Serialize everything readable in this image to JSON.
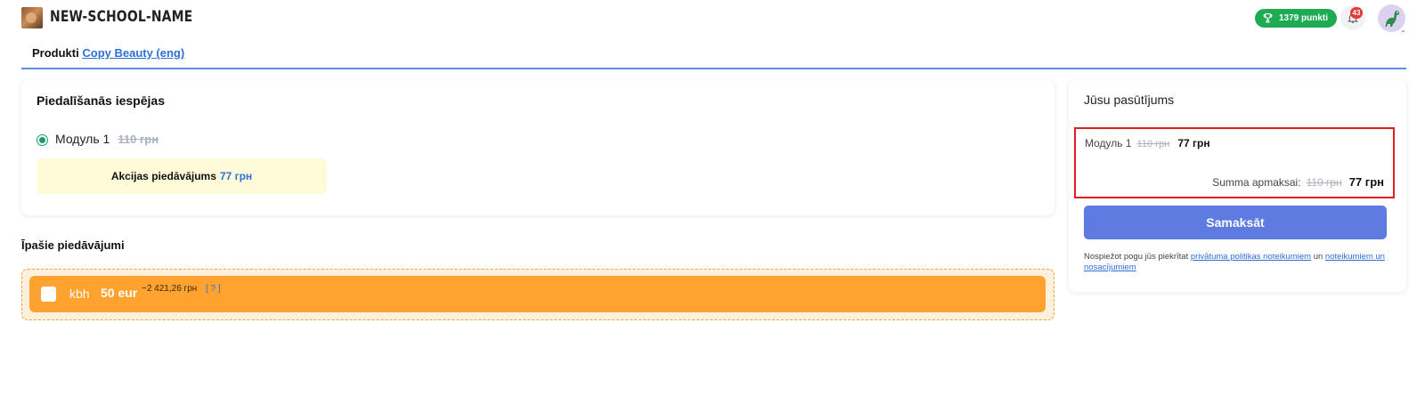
{
  "header": {
    "school_name": "NEW-SCHOOL-NAME",
    "points_label": "1379 punkti",
    "notifications_count": "43"
  },
  "breadcrumb": {
    "prefix": "Produkti",
    "link": "Copy Beauty (eng)"
  },
  "participation": {
    "title": "Piedalīšanās iespējas",
    "option_label": "Модуль 1",
    "option_old_price": "110 грн",
    "promo_label": "Akcijas piedāvājums",
    "promo_price": "77 грн"
  },
  "special_offers": {
    "title": "Īpašie piedāvājumi",
    "item_name": "kbh",
    "item_price": "50 eur",
    "item_approx": "~2 421,26 грн",
    "item_help": "[ ? ]"
  },
  "order": {
    "title": "Jūsu pasūtījums",
    "line_label": "Модуль 1",
    "line_old_price": "110 грн",
    "line_new_price": "77 грн",
    "sum_label": "Summa apmaksai:",
    "sum_old_price": "110 грн",
    "sum_new_price": "77 грн",
    "pay_label": "Samaksāt",
    "terms_prefix": "Nospiežot pogu jūs piekrītat",
    "terms_link1": "privātuma politikas noteikumiem",
    "terms_and": "un",
    "terms_link2": "noteikumiem un nosacījumiem"
  },
  "colors": {
    "accent_blue": "#5e7be2",
    "link_blue": "#2e6fd8",
    "points_green": "#1fab54",
    "offer_orange": "#ffa230",
    "highlight_red": "#e02020"
  },
  "icons": [
    "trophy-icon",
    "bell-icon",
    "dinosaur-avatar-icon"
  ]
}
